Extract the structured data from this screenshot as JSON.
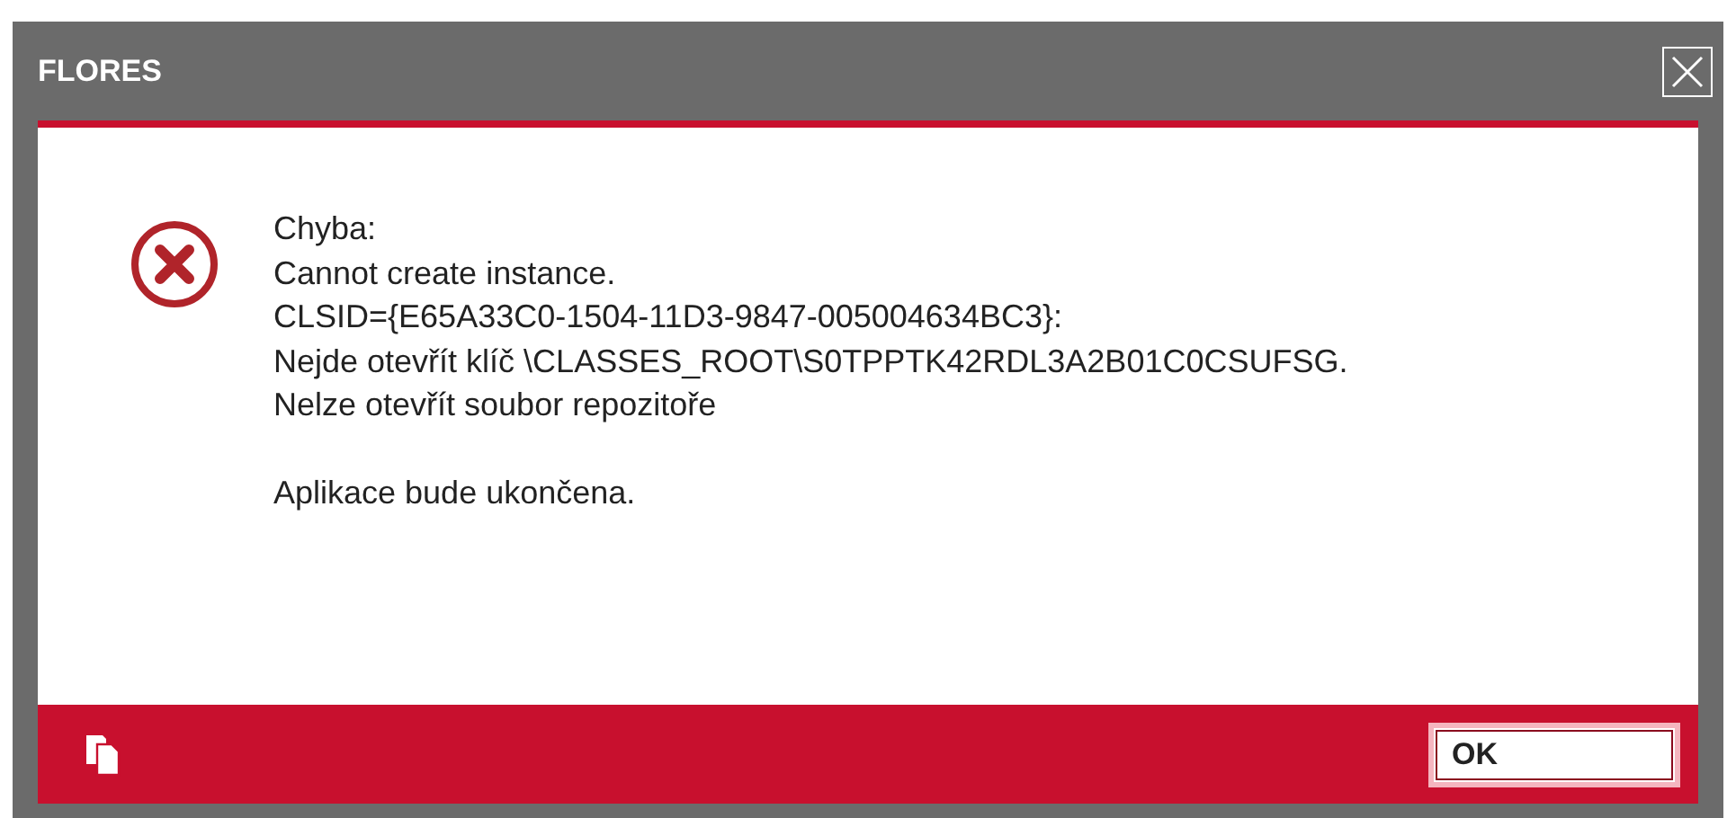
{
  "window": {
    "title": "FLORES"
  },
  "message": {
    "paragraphs": [
      {
        "lines": [
          "Chyba:",
          "Cannot create instance.",
          "CLSID={E65A33C0-1504-11D3-9847-005004634BC3}:",
          "Nejde otevřít klíč \\CLASSES_ROOT\\S0TPPTK42RDL3A2B01C0CSUFSG.",
          "Nelze otevřít soubor repozitoře"
        ]
      },
      {
        "lines": [
          "Aplikace bude ukončena."
        ]
      }
    ]
  },
  "buttons": [
    {
      "label": "OK"
    }
  ]
}
